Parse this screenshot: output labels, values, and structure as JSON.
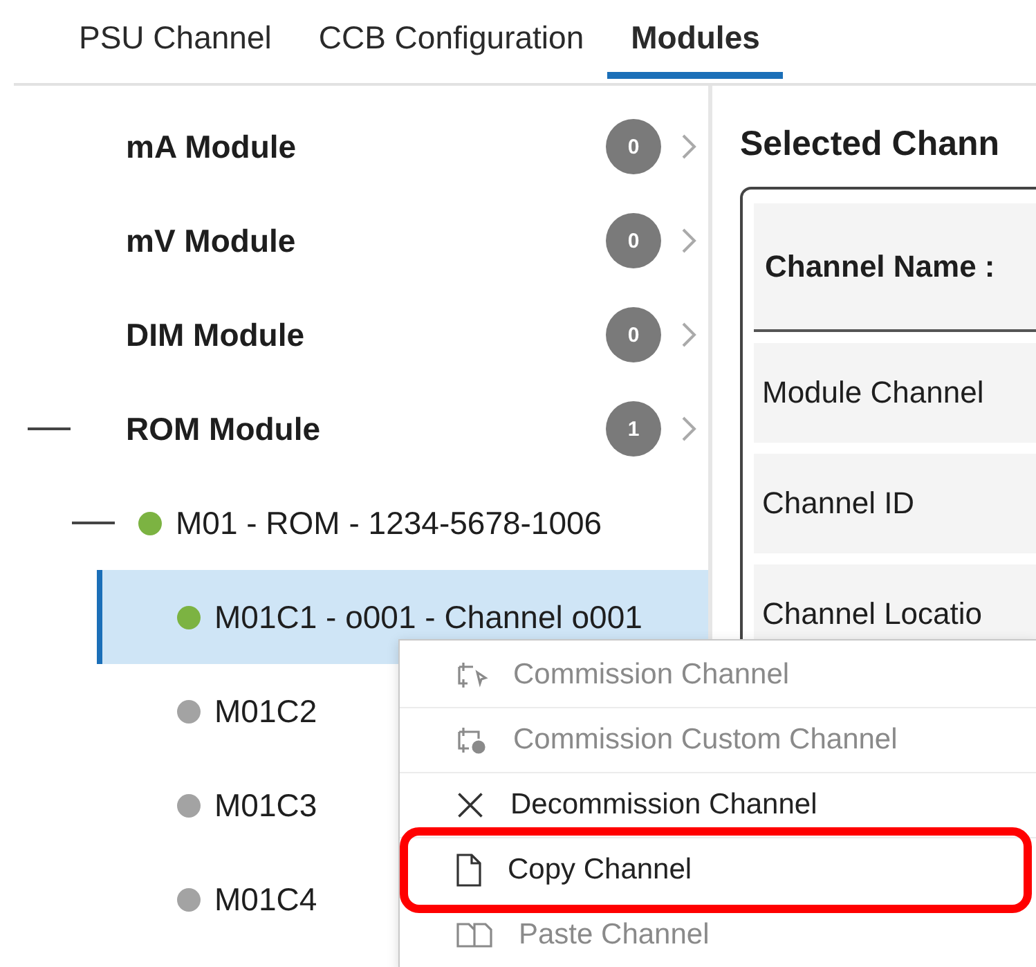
{
  "tabs": [
    {
      "label": "PSU Channel",
      "selected": false
    },
    {
      "label": "CCB Configuration",
      "selected": false
    },
    {
      "label": "Modules",
      "selected": true
    }
  ],
  "tree": [
    {
      "label": "mA Module",
      "count": "0",
      "expanded": false
    },
    {
      "label": "mV Module",
      "count": "0",
      "expanded": false
    },
    {
      "label": "DIM Module",
      "count": "0",
      "expanded": false
    },
    {
      "label": "ROM Module",
      "count": "1",
      "expanded": true,
      "children": [
        {
          "label": "M01 - ROM - 1234-5678-1006",
          "color": "#7cb342",
          "expanded": true,
          "children": [
            {
              "label": "M01C1 - o001 - Channel o001",
              "color": "#7cb342",
              "selected": true
            },
            {
              "label": "M01C2",
              "color": "#a3a3a3",
              "selected": false
            },
            {
              "label": "M01C3",
              "color": "#a3a3a3",
              "selected": false
            },
            {
              "label": "M01C4",
              "color": "#a3a3a3",
              "selected": false
            }
          ]
        }
      ]
    }
  ],
  "details": {
    "title": "Selected Chann",
    "header": "Channel Name :",
    "rows": [
      "Module Channel",
      "Channel ID",
      "Channel Locatio"
    ]
  },
  "context_menu": [
    {
      "label": "Commission Channel",
      "disabled": true,
      "highlighted": false
    },
    {
      "label": "Commission Custom Channel",
      "disabled": true,
      "highlighted": false
    },
    {
      "label": "Decommission Channel",
      "disabled": false,
      "highlighted": false
    },
    {
      "label": "Copy Channel",
      "disabled": false,
      "highlighted": true
    },
    {
      "label": "Paste Channel",
      "disabled": true,
      "highlighted": false
    }
  ]
}
